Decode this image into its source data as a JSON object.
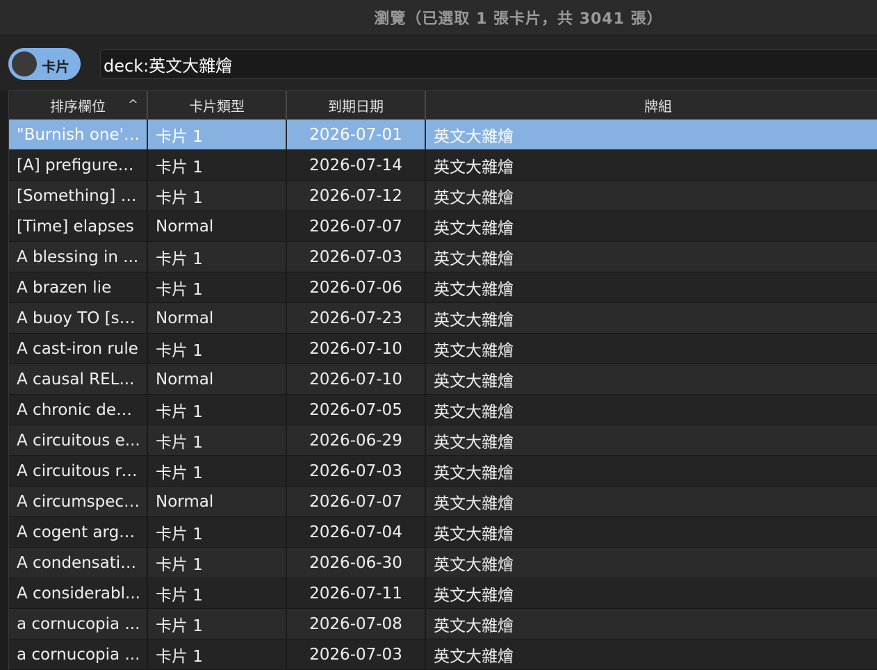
{
  "window": {
    "title": "瀏覽（已選取 1 張卡片，共 3041 張）"
  },
  "toolbar": {
    "toggle_label": "卡片",
    "search_value": "deck:英文大雜燴"
  },
  "table": {
    "columns": [
      "排序欄位",
      "卡片類型",
      "到期日期",
      "牌組"
    ],
    "sort_indicator": "^",
    "selected_index": 0,
    "rows": [
      {
        "sort": "\"Burnish one's...",
        "type": "卡片 1",
        "due": "2026-07-01",
        "deck": "英文大雜燴"
      },
      {
        "sort": "[A] prefigures ...",
        "type": "卡片 1",
        "due": "2026-07-14",
        "deck": "英文大雜燴"
      },
      {
        "sort": "[Something] p...",
        "type": "卡片 1",
        "due": "2026-07-12",
        "deck": "英文大雜燴"
      },
      {
        "sort": "[Time] elapses",
        "type": "Normal",
        "due": "2026-07-07",
        "deck": "英文大雜燴"
      },
      {
        "sort": "A blessing in ...",
        "type": "卡片 1",
        "due": "2026-07-03",
        "deck": "英文大雜燴"
      },
      {
        "sort": "A brazen lie",
        "type": "卡片 1",
        "due": "2026-07-06",
        "deck": "英文大雜燴"
      },
      {
        "sort": "A buoy TO [so...",
        "type": "Normal",
        "due": "2026-07-23",
        "deck": "英文大雜燴"
      },
      {
        "sort": "A cast-iron rule",
        "type": "卡片 1",
        "due": "2026-07-10",
        "deck": "英文大雜燴"
      },
      {
        "sort": "A causal REL...",
        "type": "Normal",
        "due": "2026-07-10",
        "deck": "英文大雜燴"
      },
      {
        "sort": "A chronic dearth",
        "type": "卡片 1",
        "due": "2026-07-05",
        "deck": "英文大雜燴"
      },
      {
        "sort": "A circuitous e...",
        "type": "卡片 1",
        "due": "2026-06-29",
        "deck": "英文大雜燴"
      },
      {
        "sort": "A circuitous ro...",
        "type": "卡片 1",
        "due": "2026-07-03",
        "deck": "英文大雜燴"
      },
      {
        "sort": "A circumspect...",
        "type": "Normal",
        "due": "2026-07-07",
        "deck": "英文大雜燴"
      },
      {
        "sort": "A cogent argu...",
        "type": "卡片 1",
        "due": "2026-07-04",
        "deck": "英文大雜燴"
      },
      {
        "sort": "A condensatio...",
        "type": "卡片 1",
        "due": "2026-06-30",
        "deck": "英文大雜燴"
      },
      {
        "sort": "A considerabl...",
        "type": "卡片 1",
        "due": "2026-07-11",
        "deck": "英文大雜燴"
      },
      {
        "sort": "a cornucopia ...",
        "type": "卡片 1",
        "due": "2026-07-08",
        "deck": "英文大雜燴"
      },
      {
        "sort": "a cornucopia ...",
        "type": "卡片 1",
        "due": "2026-07-03",
        "deck": "英文大雜燴"
      }
    ]
  },
  "colors": {
    "selection": "#86b1e0",
    "toggle_bg": "#7fb0e6",
    "row_even": "#2b2b2b",
    "row_odd": "#242424"
  }
}
